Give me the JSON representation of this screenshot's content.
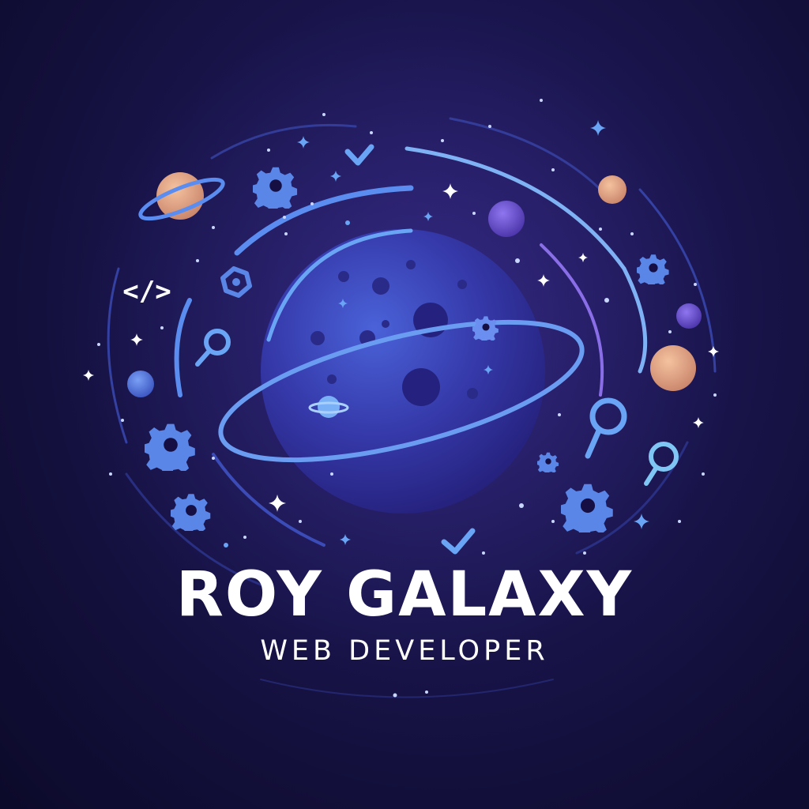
{
  "logo": {
    "name": "ROY GALAXY",
    "tagline": "WEB DEVELOPER",
    "code_glyph": "</>"
  },
  "colors": {
    "background": "#120f3a",
    "planet": "#3b3fb8",
    "orbit": "#5b8df0",
    "accent_blue": "#5a86e8",
    "peach_planet": "#e8a987",
    "purple_planet": "#6a4fd0",
    "text": "#ffffff"
  },
  "icons": [
    "code-icon",
    "gear-icon",
    "search-icon",
    "check-icon",
    "sparkle-icon",
    "hexagon-icon"
  ]
}
